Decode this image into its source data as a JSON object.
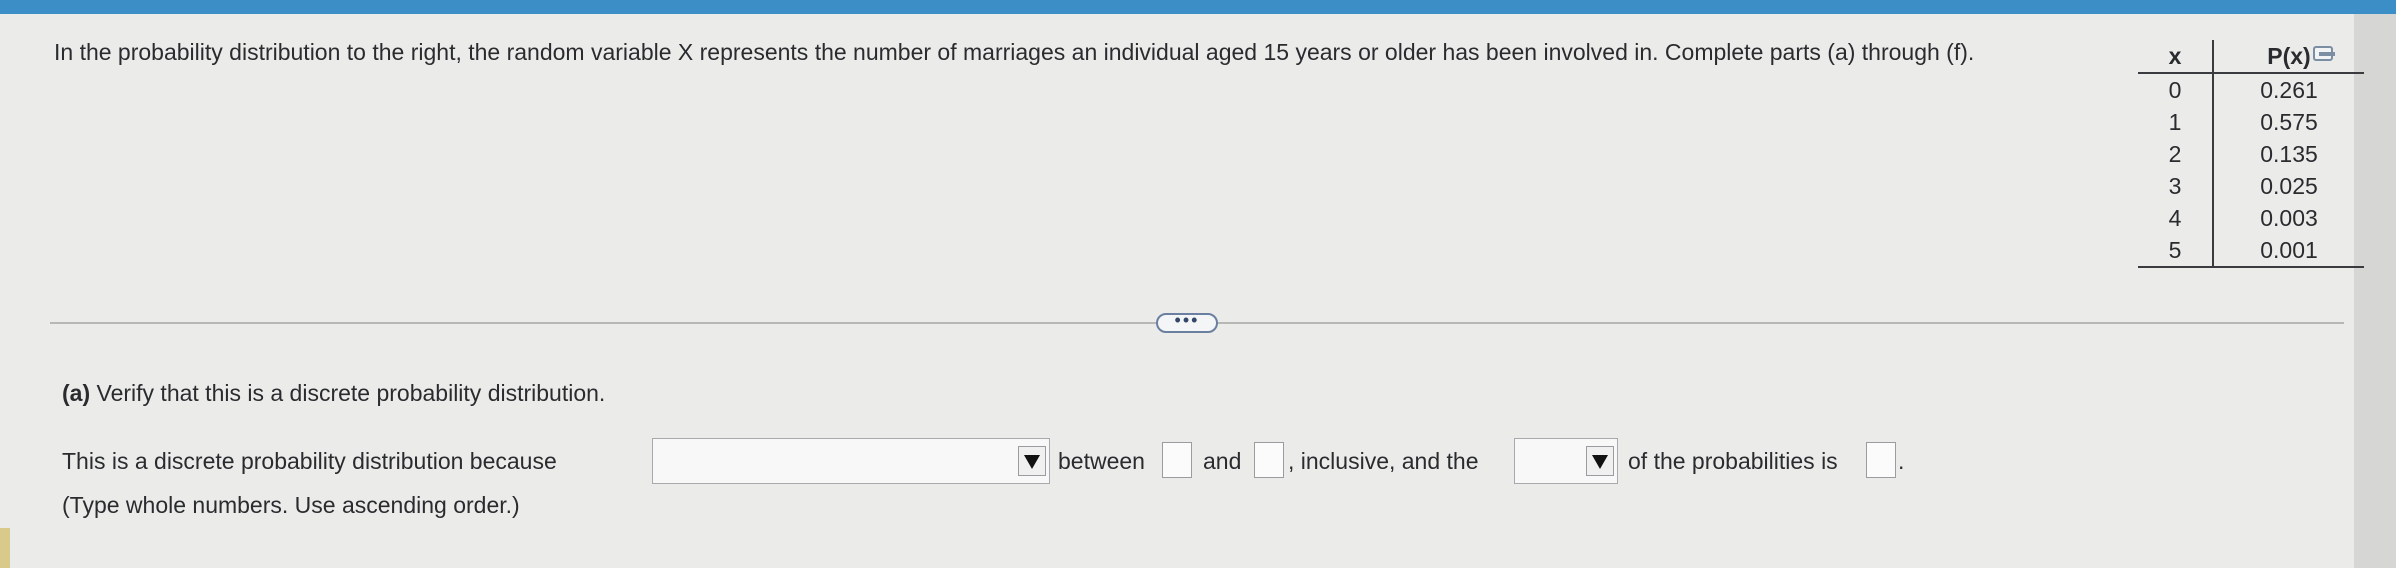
{
  "question": {
    "intro": "In the probability distribution to the right, the random variable X represents the number of marriages an individual aged 15 years or older has been involved in. Complete parts (a) through (f)."
  },
  "table": {
    "headers": [
      "x",
      "P(x)"
    ],
    "rows": [
      [
        "0",
        "0.261"
      ],
      [
        "1",
        "0.575"
      ],
      [
        "2",
        "0.135"
      ],
      [
        "3",
        "0.025"
      ],
      [
        "4",
        "0.003"
      ],
      [
        "5",
        "0.001"
      ]
    ]
  },
  "expand_button": {
    "label": "•••"
  },
  "part_a": {
    "label": "(a)",
    "prompt": "Verify that this is a discrete probability distribution.",
    "sentence_start": "This is a discrete probability distribution because",
    "between": "between",
    "and": "and",
    "inclusive": ", inclusive, and the",
    "of_the": "of the probabilities is",
    "period": ".",
    "hint": "(Type whole numbers. Use ascending order.)",
    "reason_dropdown_value": "",
    "stat_dropdown_value": "",
    "lower_value": "",
    "upper_value": "",
    "sum_value": ""
  },
  "colors": {
    "accent": "#3b8ec6",
    "panel": "#ebecea"
  }
}
